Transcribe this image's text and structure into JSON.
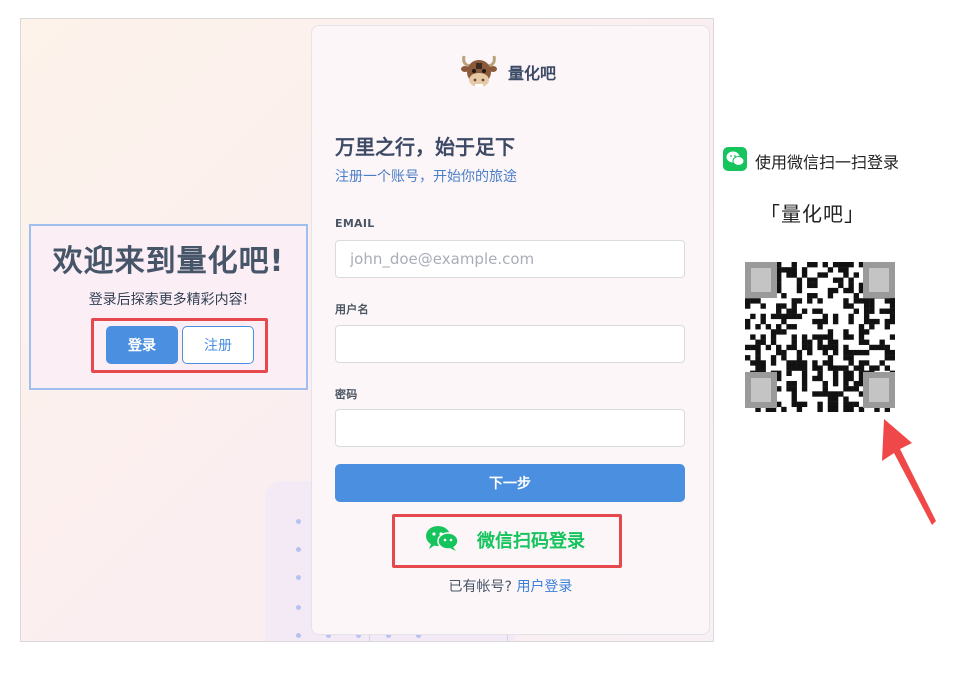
{
  "welcome": {
    "title": "欢迎来到量化吧!",
    "subtitle": "登录后探索更多精彩内容!",
    "login_label": "登录",
    "register_label": "注册"
  },
  "panel": {
    "brand_name": "量化吧",
    "headline": "万里之行，始于足下",
    "subhead": "注册一个账号，开始你的旅途",
    "email": {
      "label": "EMAIL",
      "placeholder": "john_doe@example.com",
      "value": ""
    },
    "username": {
      "label": "用户名",
      "value": ""
    },
    "password": {
      "label": "密码",
      "value": ""
    },
    "next_label": "下一步",
    "wechat_login_label": "微信扫码登录",
    "footer_prompt": "已有帐号?",
    "footer_link": "用户登录"
  },
  "qr": {
    "header": "使用微信扫一扫登录",
    "title": "「量化吧」"
  },
  "colors": {
    "accent": "#4a8fe0",
    "wechat": "#16c45e",
    "highlight": "#e5484d"
  },
  "icons": [
    "bull-logo-icon",
    "wechat-icon",
    "qr-code-icon",
    "arrow-annotation-icon"
  ]
}
